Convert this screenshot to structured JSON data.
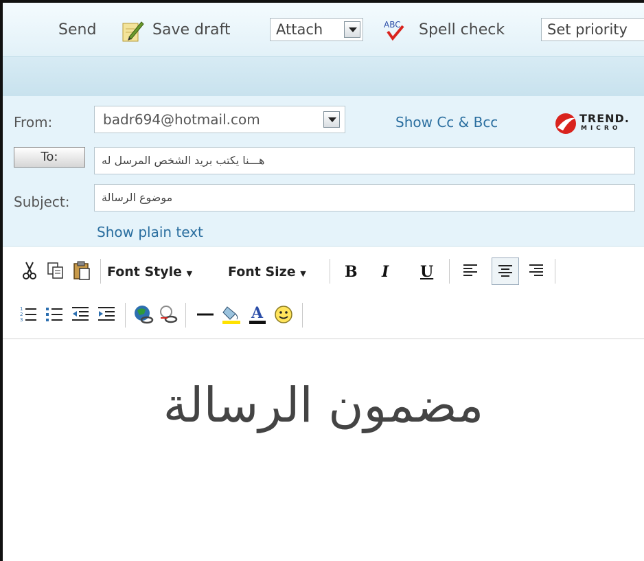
{
  "toolbar": {
    "send": "Send",
    "save_draft": "Save draft",
    "attach": "Attach",
    "spell_check": "Spell check",
    "set_priority": "Set priority"
  },
  "header": {
    "from_label": "From:",
    "from_value": "badr694@hotmail.com",
    "show_cc_bcc": "Show Cc & Bcc",
    "to_button": "To:",
    "to_value": "هـــنا يكتب بريد الشخص المرسل له",
    "subject_label": "Subject:",
    "subject_value": "موضوع الرسالة",
    "show_plain_text": "Show plain text",
    "logo_text_top": "TREND.",
    "logo_text_bottom": "MICRO"
  },
  "editor": {
    "font_style": "Font Style",
    "font_size": "Font Size",
    "bold": "B",
    "italic": "I",
    "underline": "U"
  },
  "message": {
    "body": "مضمون الرسالة"
  },
  "colors": {
    "link": "#2a6e9f",
    "header_bg": "#e5f3fa",
    "brand_red": "#d9231d"
  }
}
